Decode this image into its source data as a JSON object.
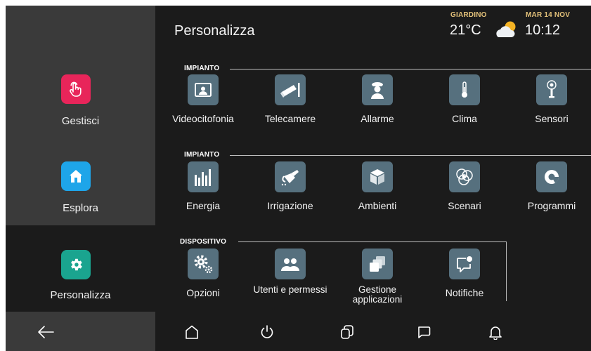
{
  "header": {
    "title": "Personalizza",
    "weather_location": "GIARDINO",
    "temperature": "21°C",
    "weather_icon": "partly-cloudy-icon",
    "date": "MAR 14 NOV",
    "time": "10:12"
  },
  "sidebar": {
    "items": [
      {
        "label": "Gestisci",
        "icon": "hand-pointer-icon",
        "color": "#e8255a"
      },
      {
        "label": "Esplora",
        "icon": "home-icon",
        "color": "#1ea5e9"
      },
      {
        "label": "Personalizza",
        "icon": "gear-icon",
        "color": "#1aa48f"
      }
    ]
  },
  "sections": [
    {
      "title": "IMPIANTO",
      "items": [
        "Videocitofonia",
        "Telecamere",
        "Allarme",
        "Clima",
        "Sensori"
      ]
    },
    {
      "title": "IMPIANTO",
      "items": [
        "Energia",
        "Irrigazione",
        "Ambienti",
        "Scenari",
        "Programmi"
      ]
    },
    {
      "title": "DISPOSITIVO",
      "items": [
        "Opzioni",
        "Utenti e permessi",
        "Gestione applicazioni",
        "Notifiche"
      ]
    }
  ],
  "bottom_nav": [
    "back-arrow-icon",
    "home-outline-icon",
    "power-icon",
    "copy-icon",
    "message-icon",
    "bell-icon"
  ],
  "colors": {
    "tile": "#56707e",
    "background": "#1b1b1b",
    "sidebar": "#3a3a3a"
  }
}
